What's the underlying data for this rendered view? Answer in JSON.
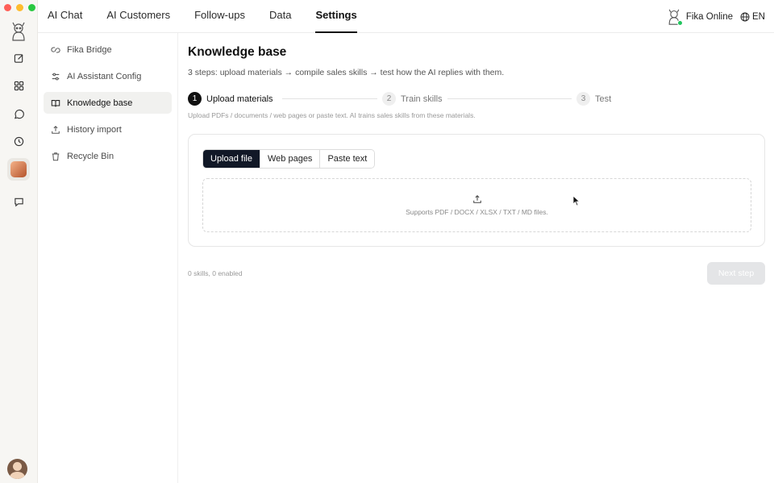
{
  "topnav": {
    "tabs": [
      {
        "label": "AI Chat"
      },
      {
        "label": "AI Customers"
      },
      {
        "label": "Follow-ups"
      },
      {
        "label": "Data"
      },
      {
        "label": "Settings",
        "active": true
      }
    ],
    "status_label": "Fika Online",
    "status_color": "#22c55e",
    "lang_label": "EN",
    "lang_icon": "globe-icon"
  },
  "rail": {
    "items": [
      {
        "icon": "compose-icon"
      },
      {
        "icon": "apps-grid-icon"
      },
      {
        "icon": "whatsapp-icon"
      },
      {
        "icon": "clock-icon"
      },
      {
        "icon": "agent-avatar",
        "active": true
      },
      {
        "icon": "chat-bubble-icon"
      }
    ]
  },
  "sidebar": {
    "items": [
      {
        "label": "Fika Bridge",
        "icon": "link-icon"
      },
      {
        "label": "AI Assistant Config",
        "icon": "sliders-icon"
      },
      {
        "label": "Knowledge base",
        "icon": "book-icon",
        "active": true
      },
      {
        "label": "History import",
        "icon": "upload-icon"
      },
      {
        "label": "Recycle Bin",
        "icon": "trash-icon"
      }
    ]
  },
  "main": {
    "title": "Knowledge base",
    "subtitle": "3 steps: upload materials → compile sales skills → test how the AI replies with them.",
    "steps": [
      {
        "num": "1",
        "label": "Upload materials",
        "state": "current"
      },
      {
        "num": "2",
        "label": "Train skills",
        "state": "pending"
      },
      {
        "num": "3",
        "label": "Test",
        "state": "pending"
      }
    ],
    "hint": "Upload PDFs / documents / web pages or paste text. AI trains sales skills from these materials.",
    "source_tabs": [
      {
        "label": "Upload file",
        "selected": true
      },
      {
        "label": "Web pages"
      },
      {
        "label": "Paste text"
      }
    ],
    "dropzone_text": "Supports PDF / DOCX / XLSX / TXT / MD files.",
    "skills_count": "0 skills, 0 enabled",
    "next_label": "Next step"
  },
  "colors": {
    "accent_dark": "#111827",
    "disabled_button": "#e4e5e7"
  }
}
